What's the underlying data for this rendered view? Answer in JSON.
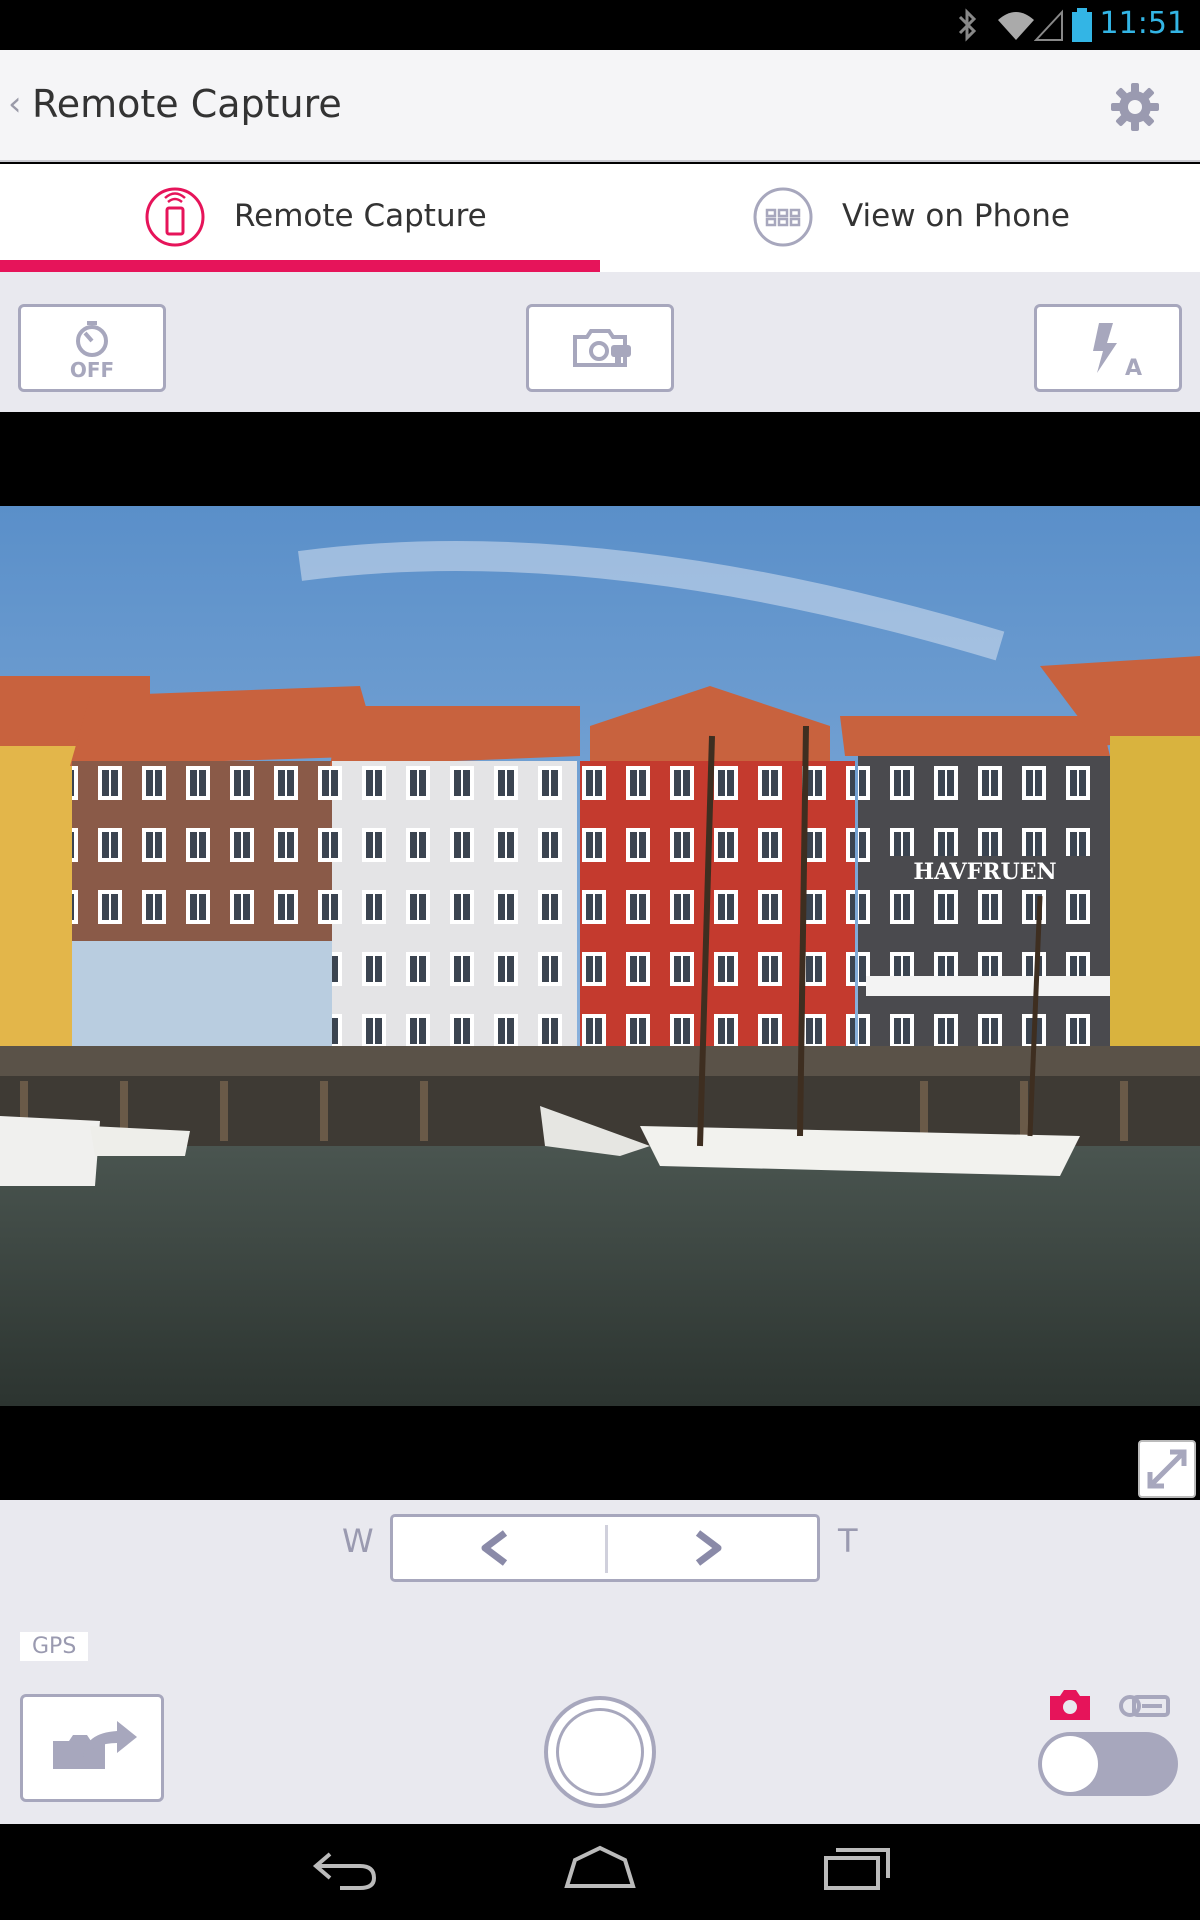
{
  "status_bar": {
    "time": "11:51"
  },
  "action_bar": {
    "title": "Remote Capture"
  },
  "tabs": [
    {
      "label": "Remote Capture",
      "selected": true,
      "icon": "phone-remote-icon"
    },
    {
      "label": "View on Phone",
      "selected": false,
      "icon": "grid-icon"
    }
  ],
  "toolbar": {
    "timer_label": "OFF",
    "flash_label": "A"
  },
  "photo": {
    "sign_text": "HAVFRUEN"
  },
  "zoom": {
    "wide_label": "W",
    "tele_label": "T"
  },
  "gps_label": "GPS",
  "colors": {
    "accent": "#e6145a",
    "control_border": "#a7a7bd",
    "background": "#e9e9ef"
  },
  "mode": {
    "current": "photo"
  }
}
